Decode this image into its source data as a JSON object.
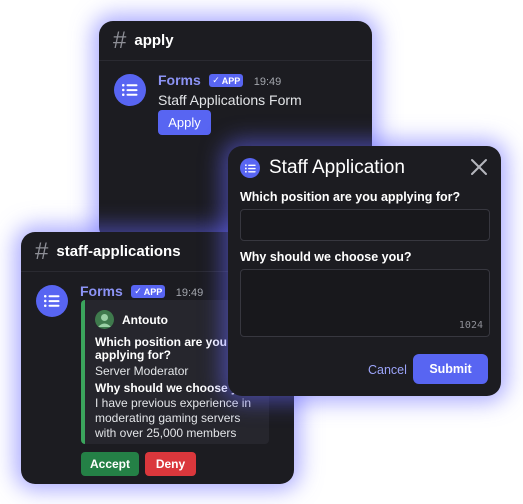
{
  "apply_panel": {
    "channel": "apply",
    "bot_name": "Forms",
    "badge": "APP",
    "time": "19:49",
    "message": "Staff Applications Form",
    "apply_button": "Apply"
  },
  "staff_panel": {
    "channel": "staff-applications",
    "bot_name": "Forms",
    "badge": "APP",
    "time": "19:49",
    "embed": {
      "author": "Antouto",
      "q1_line1": "Which position are you",
      "q1_line2": "applying for?",
      "a1": "Server Moderator",
      "q2": "Why should we choose you?",
      "a2_line1": "I have previous experience in",
      "a2_line2": "moderating gaming servers",
      "a2_line3": "with over 25,000 members"
    },
    "accept_button": "Accept",
    "deny_button": "Deny"
  },
  "modal": {
    "title": "Staff Application",
    "field1_label": "Which position are you applying for?",
    "field1_value": "",
    "field2_label": "Why should we choose you?",
    "field2_value": "",
    "field2_counter": "1024",
    "cancel": "Cancel",
    "submit": "Submit"
  },
  "colors": {
    "accent": "#5865f2",
    "accept": "#248046",
    "deny": "#da373c",
    "panel_bg": "#1c1c21",
    "glow": "#6666ff"
  }
}
